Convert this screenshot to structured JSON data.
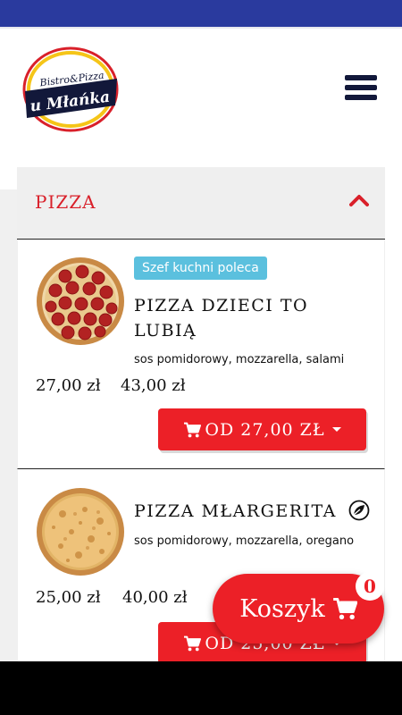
{
  "brand": {
    "logo_top_text": "Bistro&Pizza",
    "logo_main_text": "u Młańka",
    "colors": {
      "navy": "#12183a",
      "red": "#d9202a",
      "yellow": "#f5c518"
    }
  },
  "header": {
    "menu_icon": "hamburger-menu-icon"
  },
  "category": {
    "title": "PIZZA",
    "toggle_icon": "chevron-up-icon"
  },
  "products": [
    {
      "badge": "Szef kuchni poleca",
      "name": "PIZZA DZIECI TO LUBIĄ",
      "ingredients": "sos pomidorowy, mozzarella, salami",
      "prices": [
        "27,00 zł",
        "43,00 zł"
      ],
      "button_label": "OD 27,00 ZŁ",
      "image": "pepperoni-pizza"
    },
    {
      "name": "PIZZA MŁARGERITA",
      "vegetarian_icon": "leaf-icon",
      "ingredients": "sos pomidorowy, mozzarella, oregano",
      "prices": [
        "25,00 zł",
        "40,00 zł"
      ],
      "button_label": "OD 25,00 ZŁ",
      "image": "margherita-pizza"
    }
  ],
  "cart": {
    "label": "Koszyk",
    "count": "0",
    "icon": "cart-icon"
  },
  "theme": {
    "accent": "#ec2027",
    "status_bar": "#2a3a9e",
    "badge": "#5bc0de"
  }
}
